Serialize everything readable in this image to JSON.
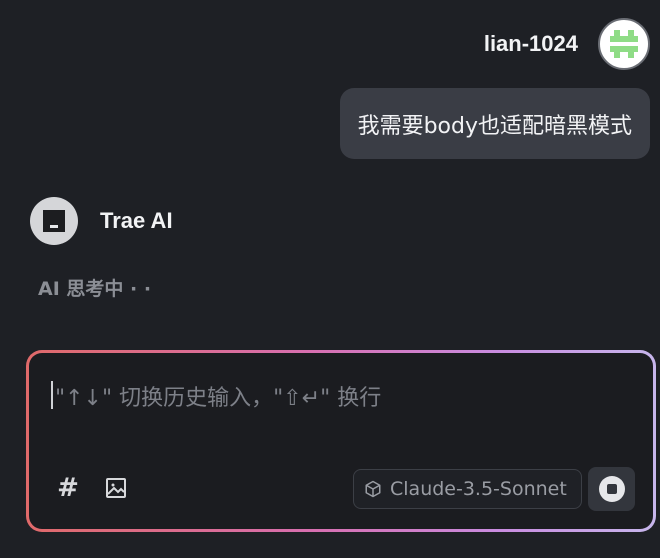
{
  "user_message": {
    "username": "lian-1024",
    "text": "我需要body也适配暗黑模式",
    "avatar_icon": "identicon-avatar"
  },
  "assistant": {
    "name": "Trae AI",
    "status": "AI 思考中 · ·",
    "avatar_icon": "trae-logo-icon"
  },
  "composer": {
    "placeholder": "\"↑↓\" 切换历史输入，\"⇧↵\" 换行",
    "hash_label": "#",
    "model": "Claude-3.5-Sonnet",
    "model_icon": "cube-icon",
    "stop_icon": "stop-icon",
    "image_icon": "image-icon"
  },
  "colors": {
    "background": "#1e2025",
    "bubble": "#3a3d45",
    "avatar_green": "#8fdc86",
    "gradient_start": "#e06a6a",
    "gradient_end": "#c7b6ec"
  }
}
